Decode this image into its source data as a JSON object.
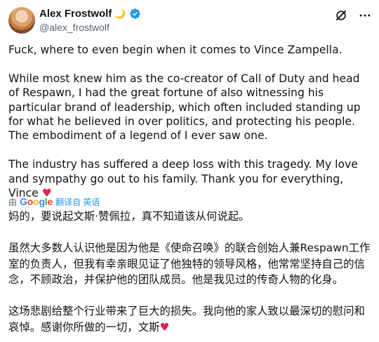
{
  "author": {
    "display_name": "Alex Frostwolf",
    "emoji": "🌙",
    "handle": "@alex_frostwolf"
  },
  "tweet": {
    "paragraph1": "Fuck, where to even begin when it comes to Vince Zampella.",
    "paragraph2": "While most knew him as the co-creator of Call of Duty and head of Respawn, I had the great fortune of also witnessing his particular brand of leadership, which often included standing up for what he believed in over politics, and protecting his people. The embodiment of a legend of I ever saw one.",
    "paragraph3": "The industry has suffered a deep loss with this tragedy. My love and sympathy go out to his family. Thank you for everything, Vince",
    "heart": "♥"
  },
  "translation": {
    "by": "由",
    "provider_letters": [
      "G",
      "o",
      "o",
      "g",
      "l",
      "e"
    ],
    "link": "翻译自 英语",
    "paragraph1": "妈的，要说起文斯·赞佩拉，真不知道该从何说起。",
    "paragraph2": "虽然大多数人认识他是因为他是《使命召唤》的联合创始人兼Respawn工作室的负责人，但我有幸亲眼见证了他独特的领导风格，他常常坚持自己的信念，不顾政治，并保护他的团队成员。他是我见过的传奇人物的化身。",
    "paragraph3": "这场悲剧给整个行业带来了巨大的损失。我向他的家人致以最深切的慰问和哀悼。感谢你所做的一切，文斯",
    "heart": "♥"
  },
  "colors": {
    "verified": "#1d9bf0",
    "link": "#1d9bf0",
    "heart": "#e0244f",
    "secondary_text": "#536471"
  },
  "icons": {
    "verified": "verified-badge-icon",
    "grok": "grok-icon",
    "more": "more-icon"
  }
}
